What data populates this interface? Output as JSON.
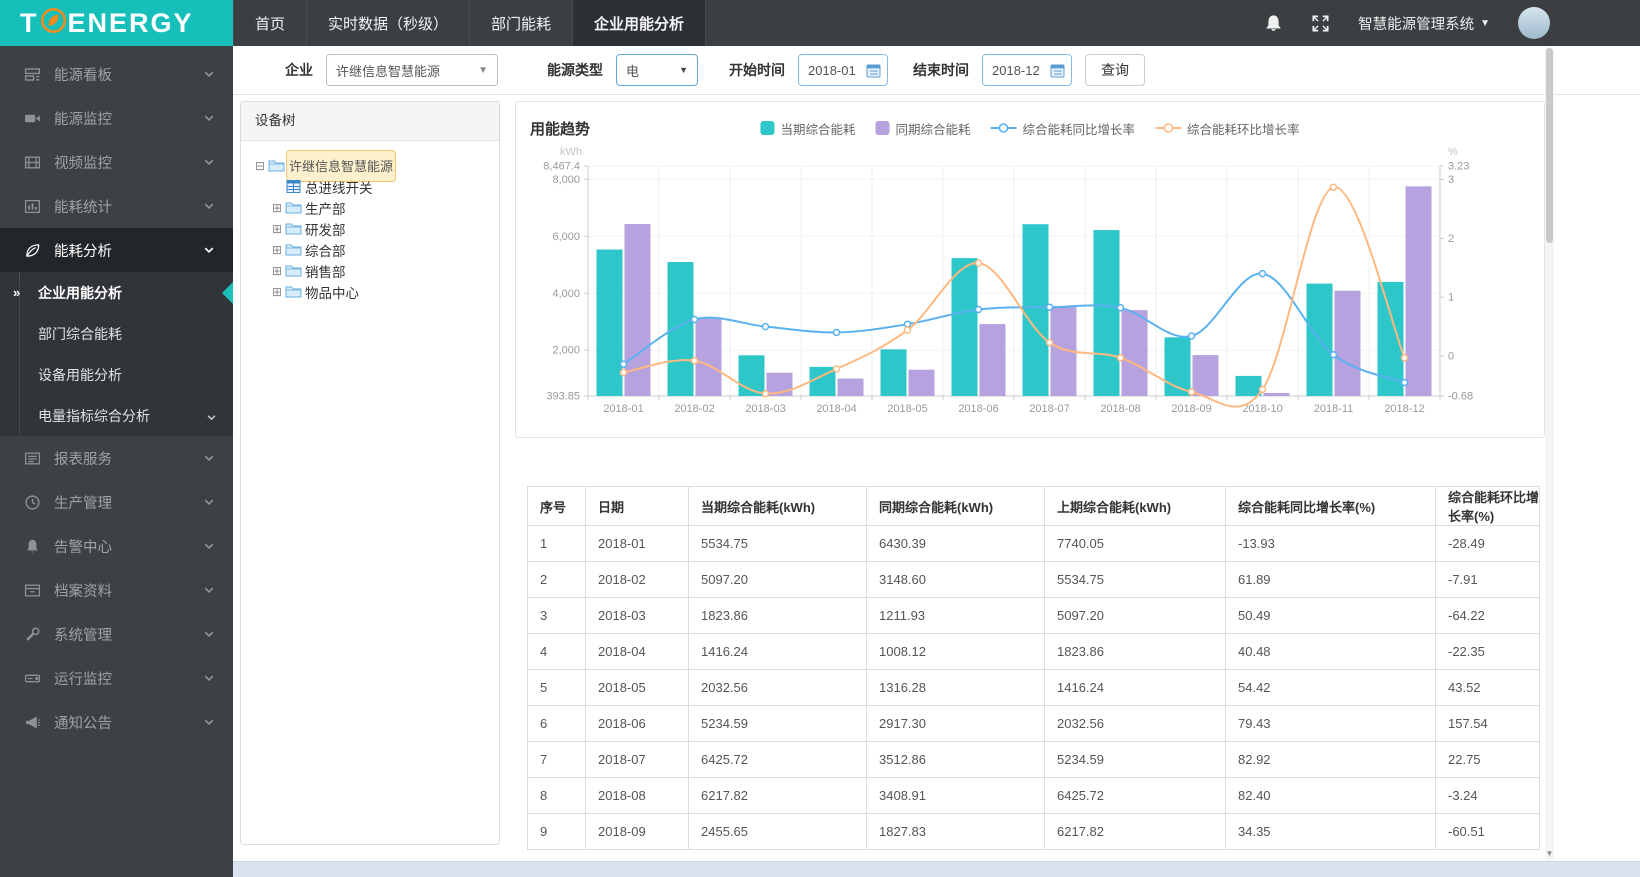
{
  "topbar": {
    "logo_left": "T",
    "logo_right": "ENERGY",
    "tabs": [
      {
        "label": "首页",
        "active": false
      },
      {
        "label": "实时数据（秒级）",
        "active": false
      },
      {
        "label": "部门能耗",
        "active": false
      },
      {
        "label": "企业用能分析",
        "active": true
      }
    ],
    "system_name": "智慧能源管理系统"
  },
  "sidebar": {
    "items": [
      {
        "label": "能源看板",
        "icon": "dashboard"
      },
      {
        "label": "能源监控",
        "icon": "camera"
      },
      {
        "label": "视频监控",
        "icon": "film"
      },
      {
        "label": "能耗统计",
        "icon": "stats"
      },
      {
        "label": "能耗分析",
        "icon": "leaf",
        "expanded": true,
        "children": [
          {
            "label": "企业用能分析",
            "active": true
          },
          {
            "label": "部门综合能耗",
            "active": false
          },
          {
            "label": "设备用能分析",
            "active": false
          },
          {
            "label": "电量指标综合分析",
            "active": false,
            "has_children": true
          }
        ]
      },
      {
        "label": "报表服务",
        "icon": "report"
      },
      {
        "label": "生产管理",
        "icon": "clock"
      },
      {
        "label": "告警中心",
        "icon": "bell"
      },
      {
        "label": "档案资料",
        "icon": "archive"
      },
      {
        "label": "系统管理",
        "icon": "wrench"
      },
      {
        "label": "运行监控",
        "icon": "drive"
      },
      {
        "label": "通知公告",
        "icon": "megaphone"
      }
    ]
  },
  "filters": {
    "company_label": "企业",
    "company_value": "许继信息智慧能源",
    "energy_label": "能源类型",
    "energy_value": "电",
    "start_label": "开始时间",
    "start_value": "2018-01",
    "end_label": "结束时间",
    "end_value": "2018-12",
    "query_label": "查询"
  },
  "device_tree": {
    "header": "设备树",
    "nodes": [
      {
        "label": "许继信息智慧能源",
        "icon": "folder",
        "toggle": "minus",
        "level": 0,
        "selected": true
      },
      {
        "label": "总进线开关",
        "icon": "meter",
        "toggle": "none",
        "level": 1,
        "selected": false
      },
      {
        "label": "生产部",
        "icon": "folder",
        "toggle": "plus",
        "level": 1,
        "selected": false
      },
      {
        "label": "研发部",
        "icon": "folder",
        "toggle": "plus",
        "level": 1,
        "selected": false
      },
      {
        "label": "综合部",
        "icon": "folder",
        "toggle": "plus",
        "level": 1,
        "selected": false
      },
      {
        "label": "销售部",
        "icon": "folder",
        "toggle": "plus",
        "level": 1,
        "selected": false
      },
      {
        "label": "物品中心",
        "icon": "folder",
        "toggle": "plus",
        "level": 1,
        "selected": false
      }
    ]
  },
  "chart": {
    "title": "用能趋势"
  },
  "chart_data": {
    "type": "bar+line",
    "categories": [
      "2018-01",
      "2018-02",
      "2018-03",
      "2018-04",
      "2018-05",
      "2018-06",
      "2018-07",
      "2018-08",
      "2018-09",
      "2018-10",
      "2018-11",
      "2018-12"
    ],
    "left_axis": {
      "name": "kWh",
      "min": 393.85,
      "max": 8467.4,
      "ticks": [
        "8,467.4",
        "8,000",
        "6,000",
        "4,000",
        "2,000",
        "393.85"
      ],
      "tick_values": [
        8467.4,
        8000,
        6000,
        4000,
        2000,
        393.85
      ]
    },
    "right_axis": {
      "name": "%",
      "min": -0.68,
      "max": 3.23,
      "ticks": [
        "3.23",
        "3",
        "2",
        "1",
        "0",
        "-0.68"
      ],
      "tick_values": [
        3.23,
        3,
        2,
        1,
        0,
        -0.68
      ]
    },
    "grid": true,
    "legend_position": "top",
    "series": [
      {
        "name": "当期综合能耗",
        "type": "bar",
        "color": "#2ec7c9",
        "y_axis": "left",
        "values": [
          5534.75,
          5097.2,
          1823.86,
          1416.24,
          2032.56,
          5234.59,
          6425.72,
          6217.82,
          2455.65,
          1100,
          4340,
          4400
        ]
      },
      {
        "name": "同期综合能耗",
        "type": "bar",
        "color": "#b6a2de",
        "y_axis": "left",
        "values": [
          6430.39,
          3148.6,
          1211.93,
          1008.12,
          1316.28,
          2917.3,
          3512.86,
          3408.91,
          1827.83,
          500,
          4090,
          7750
        ]
      },
      {
        "name": "综合能耗同比增长率",
        "type": "line",
        "color": "#5ab1ef",
        "y_axis": "right",
        "values": [
          -0.14,
          0.62,
          0.5,
          0.4,
          0.54,
          0.79,
          0.83,
          0.82,
          0.34,
          1.4,
          0.02,
          -0.45
        ]
      },
      {
        "name": "综合能耗环比增长率",
        "type": "line",
        "color": "#ffb980",
        "y_axis": "right",
        "values": [
          -0.28,
          -0.08,
          -0.64,
          -0.22,
          0.44,
          1.58,
          0.23,
          -0.03,
          -0.61,
          -0.57,
          2.87,
          -0.03
        ]
      }
    ]
  },
  "table": {
    "columns": [
      "序号",
      "日期",
      "当期综合能耗(kWh)",
      "同期综合能耗(kWh)",
      "上期综合能耗(kWh)",
      "综合能耗同比增长率(%)",
      "综合能耗环比增长率(%)"
    ],
    "rows": [
      [
        "1",
        "2018-01",
        "5534.75",
        "6430.39",
        "7740.05",
        "-13.93",
        "-28.49"
      ],
      [
        "2",
        "2018-02",
        "5097.20",
        "3148.60",
        "5534.75",
        "61.89",
        "-7.91"
      ],
      [
        "3",
        "2018-03",
        "1823.86",
        "1211.93",
        "5097.20",
        "50.49",
        "-64.22"
      ],
      [
        "4",
        "2018-04",
        "1416.24",
        "1008.12",
        "1823.86",
        "40.48",
        "-22.35"
      ],
      [
        "5",
        "2018-05",
        "2032.56",
        "1316.28",
        "1416.24",
        "54.42",
        "43.52"
      ],
      [
        "6",
        "2018-06",
        "5234.59",
        "2917.30",
        "2032.56",
        "79.43",
        "157.54"
      ],
      [
        "7",
        "2018-07",
        "6425.72",
        "3512.86",
        "5234.59",
        "82.92",
        "22.75"
      ],
      [
        "8",
        "2018-08",
        "6217.82",
        "3408.91",
        "6425.72",
        "82.40",
        "-3.24"
      ],
      [
        "9",
        "2018-09",
        "2455.65",
        "1827.83",
        "6217.82",
        "34.35",
        "-60.51"
      ]
    ]
  },
  "scrollbar": {
    "down_arrow": "▼"
  },
  "colors": {
    "brand_teal": "#17bfba",
    "topbar_bg": "#3c3f42",
    "sidebar_bg": "#3e4144",
    "bar_current": "#2ec7c9",
    "bar_same_period": "#b6a2de",
    "line_yoy": "#5ab1ef",
    "line_mom": "#ffb980",
    "tree_selected_bg": "#fcf0cd",
    "tree_selected_border": "#f2c76f"
  }
}
